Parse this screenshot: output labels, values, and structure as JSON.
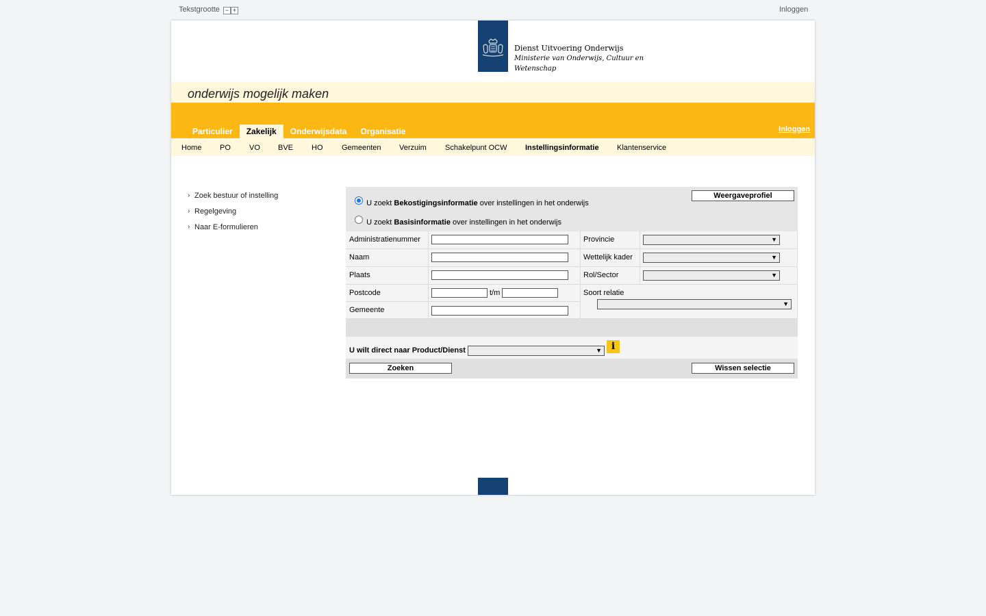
{
  "top": {
    "text_size_label": "Tekstgrootte",
    "text_size_decrease": "−",
    "text_size_increase": "+",
    "login": "Inloggen"
  },
  "logo": {
    "line1": "Dienst Uitvoering Onderwijs",
    "line2": "Ministerie van Onderwijs, Cultuur en",
    "line3": "Wetenschap"
  },
  "tagline": "onderwijs mogelijk maken",
  "main_tabs": [
    "Particulier",
    "Zakelijk",
    "Onderwijsdata",
    "Organisatie"
  ],
  "main_tab_active": "Zakelijk",
  "yellowbar_login": "Inloggen",
  "subnav": [
    "Home",
    "PO",
    "VO",
    "BVE",
    "HO",
    "Gemeenten",
    "Verzuim",
    "Schakelpunt OCW",
    "Instellingsinformatie",
    "Klantenservice"
  ],
  "subnav_active": "Instellingsinformatie",
  "sidebar": [
    "Zoek bestuur of instelling",
    "Regelgeving",
    "Naar E-formulieren"
  ],
  "form": {
    "radio1": {
      "prefix": "U zoekt",
      "bold": "Bekostigingsinformatie",
      "suffix": "over instellingen in het onderwijs",
      "checked": true
    },
    "radio2": {
      "prefix": "U zoekt",
      "bold": "Basisinformatie",
      "suffix": "over instellingen in het onderwijs",
      "checked": false
    },
    "profile_button": "Weergaveprofiel",
    "labels": {
      "administratienummer": "Administratienummer",
      "naam": "Naam",
      "plaats": "Plaats",
      "postcode": "Postcode",
      "postcode_tm": "t/m",
      "gemeente": "Gemeente",
      "provincie": "Provincie",
      "wettelijk_kader": "Wettelijk kader",
      "rol_sector": "Rol/Sector",
      "soort_relatie": "Soort relatie"
    },
    "direct_label": "U wilt direct naar Product/Dienst",
    "info_icon": "i",
    "search_button": "Zoeken",
    "clear_button": "Wissen selectie"
  },
  "colors": {
    "brand_blue": "#154273",
    "brand_yellow": "#fbb714",
    "cream": "#fff8dc"
  }
}
